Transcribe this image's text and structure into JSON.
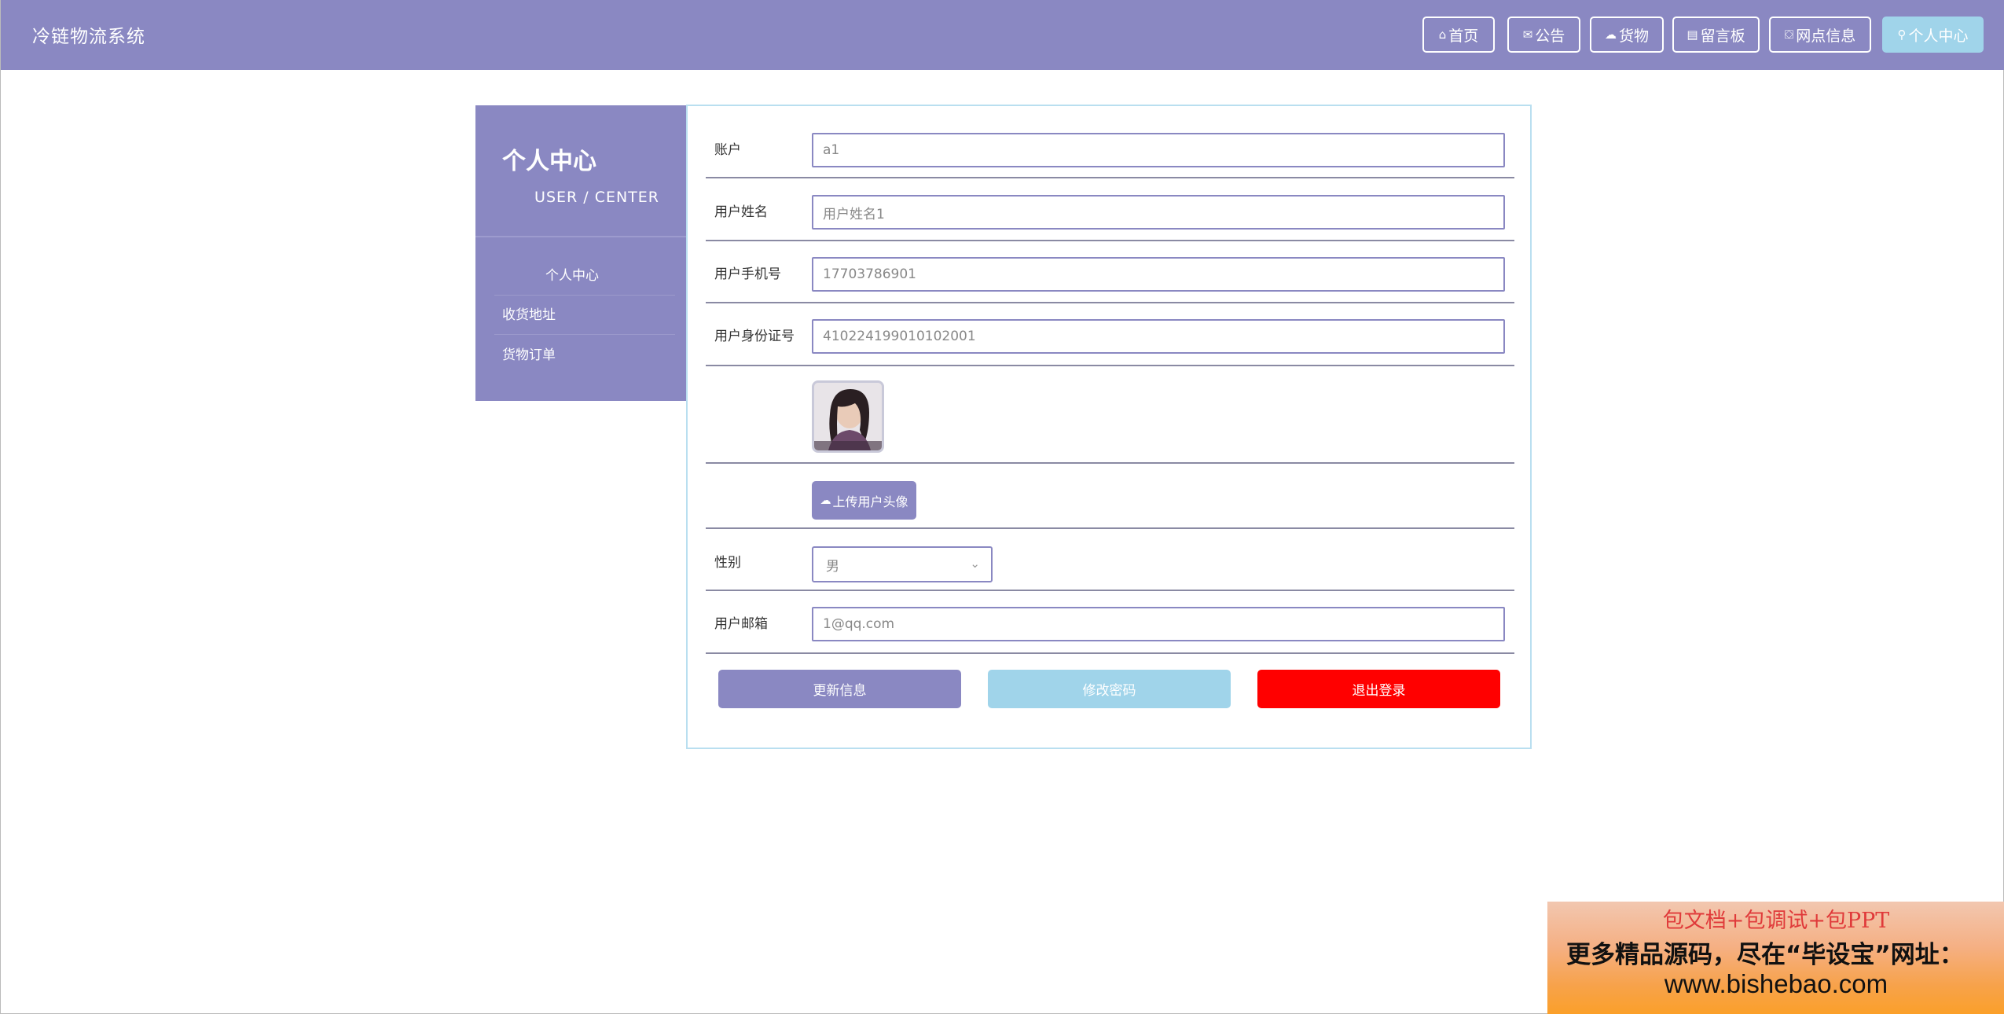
{
  "app": {
    "title": "冷链物流系统"
  },
  "nav": {
    "items": [
      {
        "label": "首页",
        "icon": "home-icon",
        "glyph": "⌂"
      },
      {
        "label": "公告",
        "icon": "mail-icon",
        "glyph": "✉"
      },
      {
        "label": "货物",
        "icon": "cloud-icon",
        "glyph": "☁"
      },
      {
        "label": "留言板",
        "icon": "board-icon",
        "glyph": "▤"
      },
      {
        "label": "网点信息",
        "icon": "shop-icon",
        "glyph": "⛋"
      },
      {
        "label": "个人中心",
        "icon": "user-icon",
        "glyph": "⚲"
      }
    ],
    "active": "个人中心"
  },
  "sidebar": {
    "title": "个人中心",
    "subtitle": "USER / CENTER",
    "items": [
      {
        "label": "个人中心"
      },
      {
        "label": "收货地址"
      },
      {
        "label": "货物订单"
      }
    ]
  },
  "form": {
    "account": {
      "label": "账户",
      "value": "a1"
    },
    "username": {
      "label": "用户姓名",
      "value": "用户姓名1"
    },
    "phone": {
      "label": "用户手机号",
      "value": "17703786901"
    },
    "id_number": {
      "label": "用户身份证号",
      "value": "410224199010102001"
    },
    "upload_label": "上传用户头像",
    "gender": {
      "label": "性别",
      "value": "男"
    },
    "email": {
      "label": "用户邮箱",
      "value": "1@qq.com"
    }
  },
  "actions": {
    "update": "更新信息",
    "change_password": "修改密码",
    "logout": "退出登录"
  },
  "colors": {
    "primary": "#8a88c2",
    "accent": "#a0d4ea",
    "danger": "#ff0000"
  },
  "ad": {
    "line1": "包文档+包调试+包PPT",
    "line2": "更多精品源码，尽在“毕设宝”网址：",
    "line3": "www.bishebao.com"
  }
}
